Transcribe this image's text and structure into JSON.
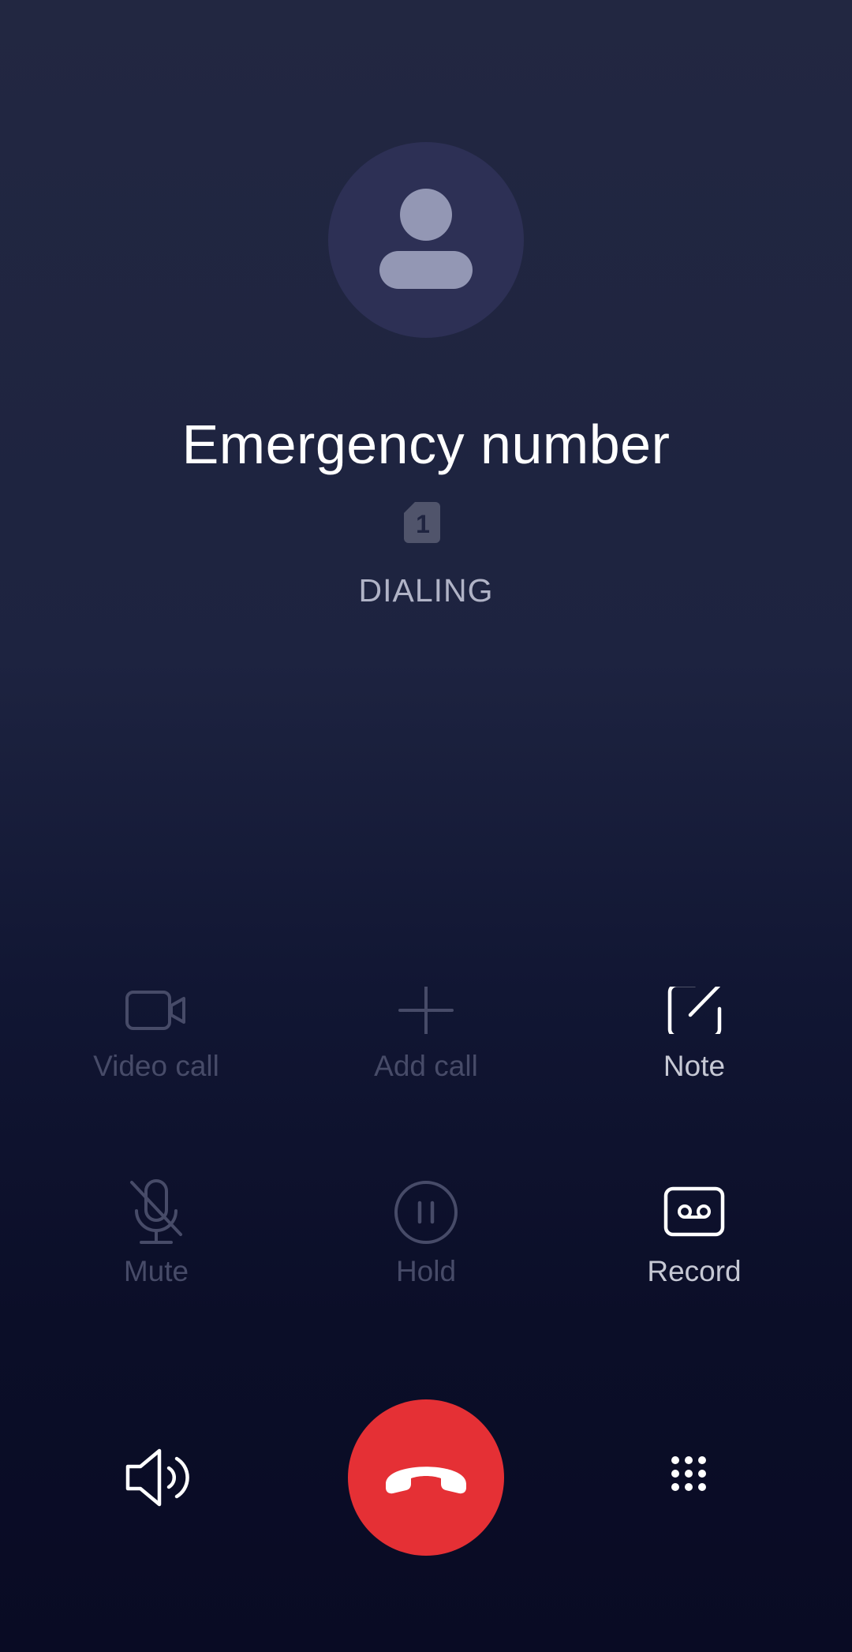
{
  "call": {
    "contact_name": "Emergency number",
    "sim_slot": "1",
    "status": "DIALING"
  },
  "actions": {
    "video_call": {
      "label": "Video call",
      "icon": "video-camera-icon",
      "enabled": false
    },
    "add_call": {
      "label": "Add call",
      "icon": "plus-icon",
      "enabled": false
    },
    "note": {
      "label": "Note",
      "icon": "note-edit-icon",
      "enabled": true
    },
    "mute": {
      "label": "Mute",
      "icon": "microphone-off-icon",
      "enabled": false
    },
    "hold": {
      "label": "Hold",
      "icon": "pause-icon",
      "enabled": false
    },
    "record": {
      "label": "Record",
      "icon": "cassette-icon",
      "enabled": true
    }
  },
  "bottom_bar": {
    "speaker_icon": "speaker-icon",
    "end_call_icon": "hang-up-icon",
    "dialpad_icon": "dialpad-icon"
  },
  "colors": {
    "end_call": "#e53035",
    "avatar_bg": "#2d3055",
    "disabled": "#474b68",
    "enabled": "#ffffff"
  }
}
